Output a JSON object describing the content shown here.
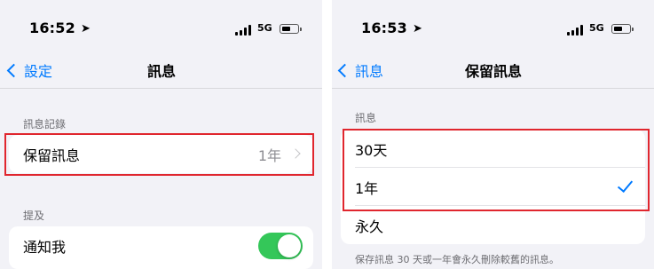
{
  "left_screen": {
    "status_bar": {
      "time": "16:52",
      "network": "5G"
    },
    "nav": {
      "back_label": "設定",
      "title": "訊息"
    },
    "sections": [
      {
        "label": "訊息記錄"
      },
      {
        "label": "提及"
      }
    ],
    "keep_messages_row": {
      "label": "保留訊息",
      "value": "1年"
    },
    "notify_me_row": {
      "label": "通知我",
      "toggle_on": true
    }
  },
  "right_screen": {
    "status_bar": {
      "time": "16:53",
      "network": "5G"
    },
    "nav": {
      "back_label": "訊息",
      "title": "保留訊息"
    },
    "section_label": "訊息",
    "options": [
      {
        "label": "30天",
        "selected": false
      },
      {
        "label": "1年",
        "selected": true
      },
      {
        "label": "永久",
        "selected": false
      }
    ],
    "footer": "保存訊息 30 天或一年會永久刪除較舊的訊息。"
  },
  "colors": {
    "accent": "#007aff",
    "toggle_on": "#34c759",
    "highlight": "#e0262e",
    "background": "#f2f2f7"
  },
  "icons": [
    "location-arrow-icon",
    "signal-icon",
    "battery-icon",
    "chevron-left-icon",
    "chevron-right-icon",
    "checkmark-icon"
  ]
}
